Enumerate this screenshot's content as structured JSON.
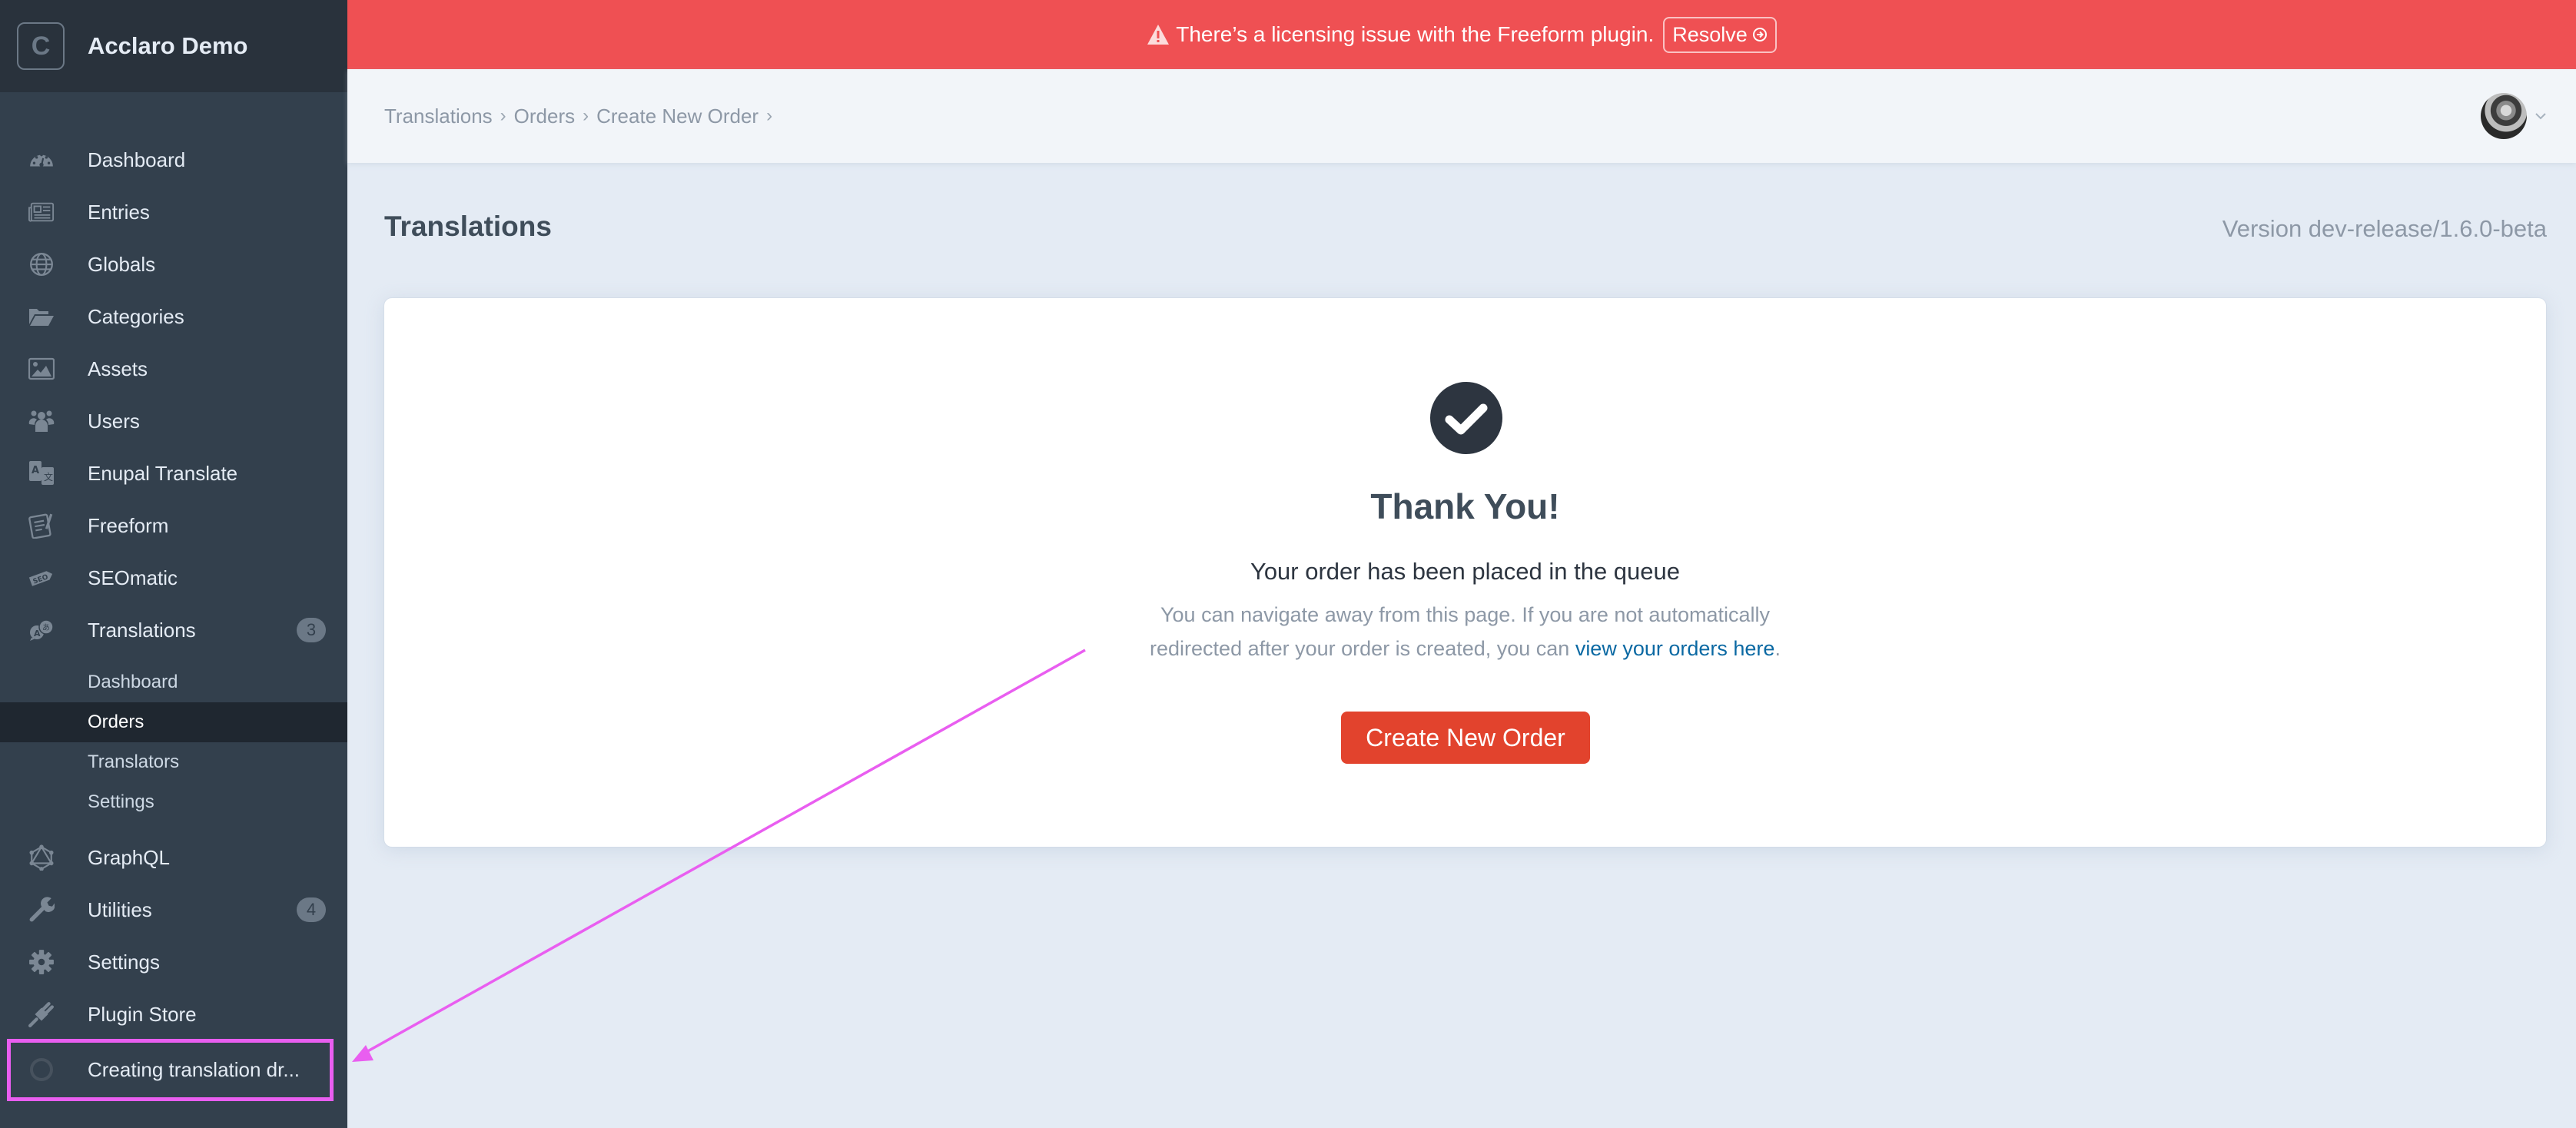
{
  "site": {
    "logo_letter": "C",
    "name": "Acclaro Demo"
  },
  "banner": {
    "message": "There’s a licensing issue with the Freeform plugin.",
    "resolve_label": "Resolve",
    "color": "#ef5053"
  },
  "sidebar": {
    "items": [
      {
        "label": "Dashboard",
        "icon": "dashboard-gauge-icon"
      },
      {
        "label": "Entries",
        "icon": "newspaper-icon"
      },
      {
        "label": "Globals",
        "icon": "globe-icon"
      },
      {
        "label": "Categories",
        "icon": "folder-open-icon"
      },
      {
        "label": "Assets",
        "icon": "image-icon"
      },
      {
        "label": "Users",
        "icon": "users-icon"
      },
      {
        "label": "Enupal Translate",
        "icon": "translate-icon"
      },
      {
        "label": "Freeform",
        "icon": "form-icon"
      },
      {
        "label": "SEOmatic",
        "icon": "seo-tag-icon"
      },
      {
        "label": "Translations",
        "icon": "translation-bubbles-icon",
        "badge": "3"
      },
      {
        "label": "GraphQL",
        "icon": "graphql-icon"
      },
      {
        "label": "Utilities",
        "icon": "wrench-icon",
        "badge": "4"
      },
      {
        "label": "Settings",
        "icon": "gear-icon"
      },
      {
        "label": "Plugin Store",
        "icon": "plug-icon"
      }
    ],
    "translations_subnav": [
      {
        "label": "Dashboard",
        "active": false
      },
      {
        "label": "Orders",
        "active": true
      },
      {
        "label": "Translators",
        "active": false
      },
      {
        "label": "Settings",
        "active": false
      }
    ],
    "job": {
      "label": "Creating translation dr..."
    }
  },
  "header": {
    "breadcrumbs": [
      "Translations",
      "Orders",
      "Create New Order"
    ],
    "separator": "›"
  },
  "page": {
    "title": "Translations",
    "version": "Version dev-release/1.6.0-beta"
  },
  "card": {
    "heading": "Thank You!",
    "subheading": "Your order has been placed in the queue",
    "info_line1": "You can navigate away from this page. If you are not automatically",
    "info_line2_prefix": "redirected after your order is created, you can ",
    "info_link": "view your orders here",
    "info_suffix": ".",
    "button_label": "Create New Order",
    "button_color": "#e2432d",
    "link_color": "#0b69a3"
  },
  "annotation": {
    "color": "#e95ef0"
  }
}
